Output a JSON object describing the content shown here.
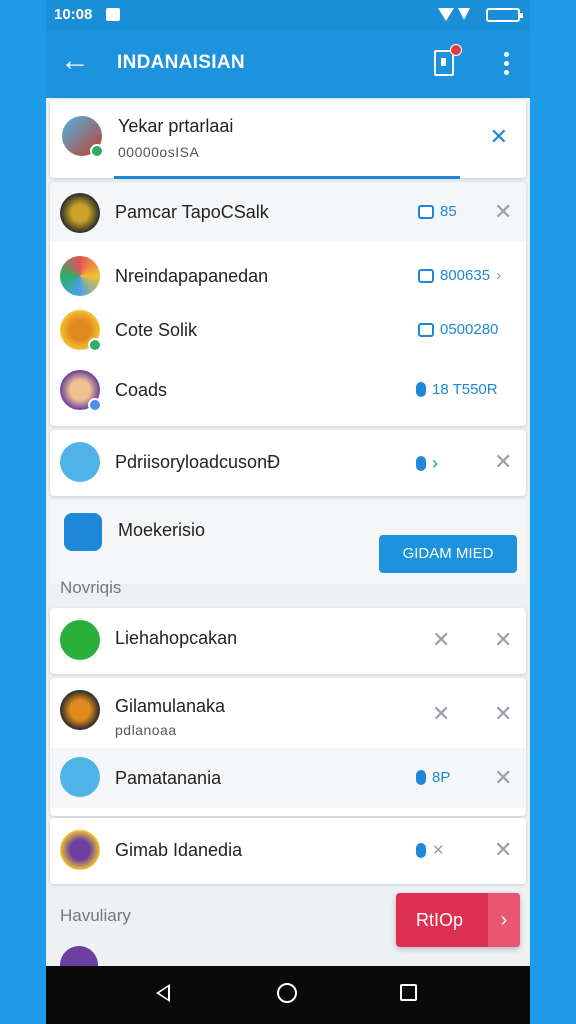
{
  "status": {
    "time": "10:08"
  },
  "appbar": {
    "title": "INDANAISIAN"
  },
  "header_card": {
    "name": "Yekar prtarlaai",
    "sub": "00000osISA"
  },
  "group1": [
    {
      "name": "Pamcar TapoCSalk",
      "chip": "85",
      "colors": [
        "#2b2b2b",
        "#c9a227"
      ]
    },
    {
      "name": "Nreindapapanedan",
      "chip": "800635",
      "colors": [
        "#e8505b",
        "#4ca0e8"
      ]
    },
    {
      "name": "Cote Solik",
      "chip": "0500280",
      "colors": [
        "#f2c230",
        "#e08a1e"
      ]
    },
    {
      "name": "Coads",
      "chip": "18 T550R",
      "colors": [
        "#6b3fa0",
        "#f0c090"
      ]
    }
  ],
  "single_row": {
    "name": "PdriisoryloadcusonÐ"
  },
  "promo_row": {
    "name": "Moekerisio",
    "button": "GIDAM MIED"
  },
  "section1": "Novriqis",
  "group2": [
    {
      "name": "Liehahopcakan",
      "sub": "",
      "chip": ""
    },
    {
      "name": "Gilamulanaka",
      "sub": "pdlanoaa",
      "chip": ""
    },
    {
      "name": "Pamatanania",
      "sub": "",
      "chip": "8P"
    },
    {
      "name": "Gimab Idanedia",
      "sub": "",
      "chip": ""
    }
  ],
  "section2": "Havuliary",
  "fab": {
    "label": "RtIOp"
  },
  "colors": {
    "accent": "#1e88d6",
    "appbar": "#1e93dd",
    "fab": "#dd2f4f"
  }
}
